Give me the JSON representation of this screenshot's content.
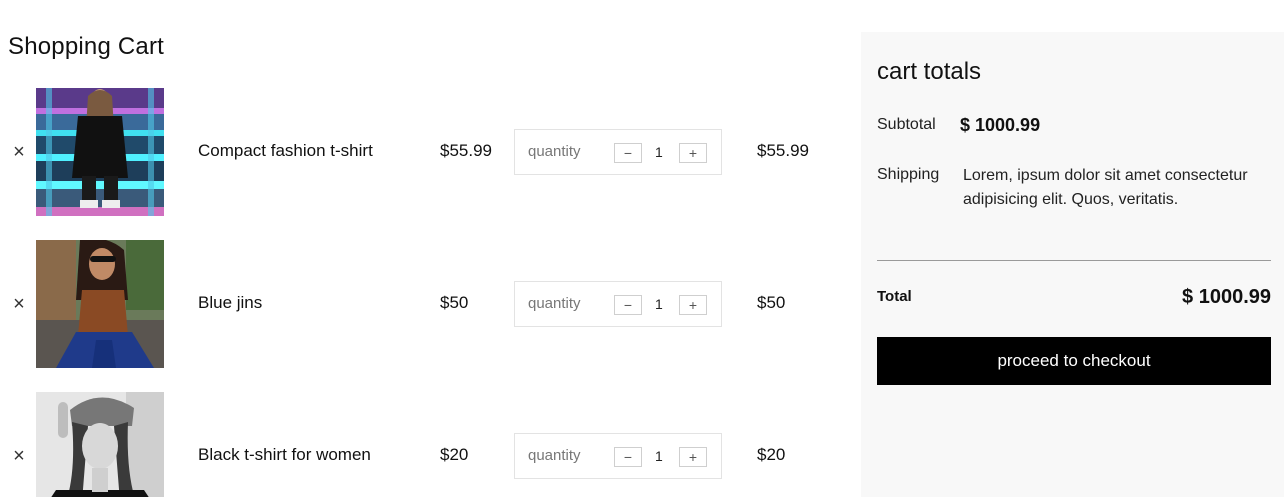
{
  "page": {
    "title": "Shopping Cart"
  },
  "cart": {
    "items": [
      {
        "remove_icon": "×",
        "image_alt": "woman in black jacket sitting on neon-lit stairs",
        "name": "Compact fashion t-shirt",
        "price": "$55.99",
        "quantity_label": "quantity",
        "minus": "−",
        "quantity": "1",
        "plus": "+",
        "total": "$55.99"
      },
      {
        "remove_icon": "×",
        "image_alt": "woman in brown top and blue jeans sitting outdoors",
        "name": "Blue jins",
        "price": "$50",
        "quantity_label": "quantity",
        "minus": "−",
        "quantity": "1",
        "plus": "+",
        "total": "$50"
      },
      {
        "remove_icon": "×",
        "image_alt": "black and white portrait of woman with beret",
        "name": "Black t-shirt for women",
        "price": "$20",
        "quantity_label": "quantity",
        "minus": "−",
        "quantity": "1",
        "plus": "+",
        "total": "$20"
      }
    ]
  },
  "totals": {
    "heading": "cart totals",
    "subtotal_label": "Subtotal",
    "subtotal_value": "$ 1000.99",
    "shipping_label": "Shipping",
    "shipping_text": "Lorem, ipsum dolor sit amet consectetur adipisicing elit. Quos, veritatis.",
    "total_label": "Total",
    "total_value": "$ 1000.99",
    "checkout_label": "proceed to checkout"
  },
  "colors": {
    "panel_bg": "#f8f8f8",
    "button_bg": "#000000",
    "button_text": "#ffffff"
  }
}
